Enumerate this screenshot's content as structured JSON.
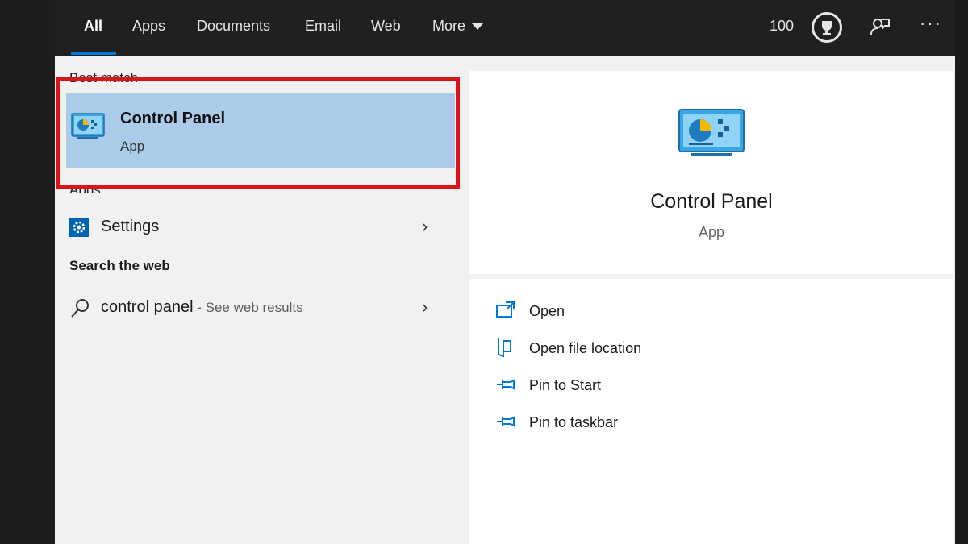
{
  "tabs": [
    {
      "label": "All"
    },
    {
      "label": "Apps"
    },
    {
      "label": "Documents"
    },
    {
      "label": "Email"
    },
    {
      "label": "Web"
    },
    {
      "label": "More"
    }
  ],
  "header": {
    "points": "100",
    "icons": [
      "trophy-icon",
      "feedback-icon",
      "more-options-icon"
    ],
    "ellipsis": "···"
  },
  "sections": {
    "best_match": "Best match",
    "apps": "Apps",
    "search_web": "Search the web"
  },
  "best_match": {
    "title": "Control Panel",
    "subtitle": "App",
    "icon": "control-panel-icon"
  },
  "apps": [
    {
      "label": "Settings",
      "icon": "settings-gear-icon"
    }
  ],
  "web_result": {
    "query": "control panel",
    "hint": " - See web results",
    "icon": "search-icon"
  },
  "detail": {
    "title": "Control Panel",
    "subtitle": "App",
    "actions": [
      {
        "label": "Open",
        "icon": "open-icon"
      },
      {
        "label": "Open file location",
        "icon": "file-location-icon"
      },
      {
        "label": "Pin to Start",
        "icon": "pin-icon"
      },
      {
        "label": "Pin to taskbar",
        "icon": "pin-icon"
      }
    ]
  },
  "colors": {
    "accent": "#0078d7",
    "selection": "#abcce8",
    "highlight_border": "#d9141b",
    "topbar": "#202020"
  }
}
